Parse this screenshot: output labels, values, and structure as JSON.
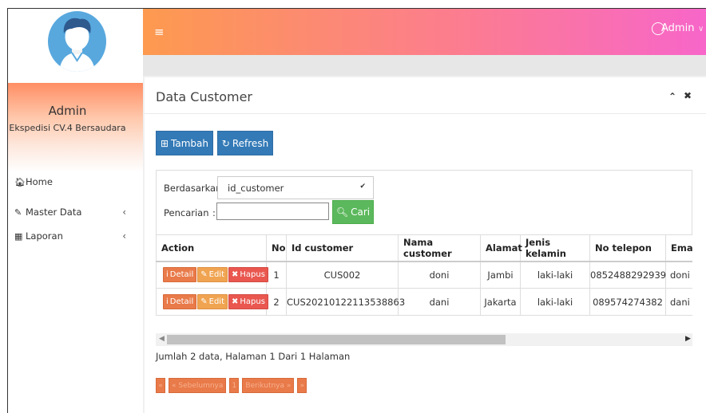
{
  "sidebar": {
    "user_name": "Admin",
    "company": "Ekspedisi CV.4 Bersaudara",
    "menu": [
      {
        "label": "Home",
        "icon": "home-icon",
        "has_children": false
      },
      {
        "label": "Master Data",
        "icon": "edit-icon",
        "has_children": true
      },
      {
        "label": "Laporan",
        "icon": "calendar-icon",
        "has_children": true
      }
    ],
    "chevron": "‹"
  },
  "topbar": {
    "menu_icon": "≡",
    "user_label": "Admin",
    "gradient": [
      "#fd9a4f",
      "#fc7d8e",
      "#f766c9"
    ]
  },
  "panel": {
    "title": "Data Customer",
    "collapse": "⌃",
    "close": "✖"
  },
  "toolbar": {
    "add_label": "Tambah",
    "refresh_label": "Refresh"
  },
  "search": {
    "by_label": "Berdasarkan:",
    "by_value": "id_customer",
    "search_label": "Pencarian",
    "colon": ":",
    "search_value": "",
    "button_label": "Cari"
  },
  "table": {
    "headers": [
      "Action",
      "No",
      "Id customer",
      "Nama customer",
      "Alamat",
      "Jenis kelamin",
      "No telepon",
      "Ema"
    ],
    "action_labels": {
      "detail": "Detail",
      "edit": "Edit",
      "delete": "Hapus"
    },
    "rows": [
      {
        "no": "1",
        "id": "CUS002",
        "nama": "doni",
        "alamat": "Jambi",
        "jk": "laki-laki",
        "telp": "0852488292939",
        "email": "doni"
      },
      {
        "no": "2",
        "id": "CUS20210122113538863",
        "nama": "dani",
        "alamat": "Jakarta",
        "jk": "laki-laki",
        "telp": "089574274382",
        "email": "dani"
      }
    ]
  },
  "summary": "Jumlah 2 data, Halaman 1 Dari 1 Halaman",
  "pagination": {
    "first": "«",
    "prev": "« Sebelumnya",
    "page": "1",
    "next": "Berikutnya »",
    "last": "»"
  },
  "colors": {
    "primary": "#337ab7",
    "success": "#5cb85c",
    "action_orange": "#e97a49"
  }
}
